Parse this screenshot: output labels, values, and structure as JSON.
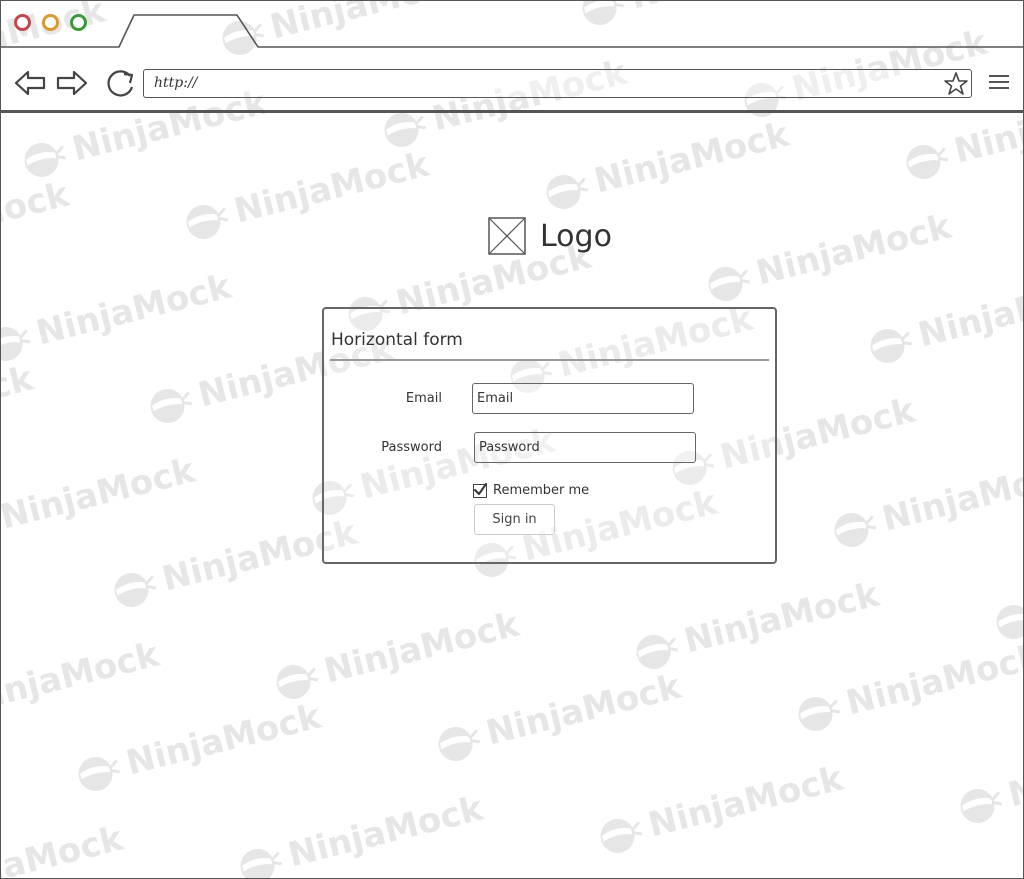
{
  "watermark": {
    "text": "NinjaMock"
  },
  "browser": {
    "window_controls": [
      "close",
      "minimize",
      "maximize"
    ],
    "url": "http://",
    "icons": {
      "back": "back-arrow-icon",
      "forward": "forward-arrow-icon",
      "reload": "reload-icon",
      "bookmark": "star-icon",
      "menu": "hamburger-menu-icon"
    }
  },
  "logo": {
    "text": "Logo",
    "icon": "image-placeholder-icon"
  },
  "form": {
    "title": "Horizontal form",
    "email": {
      "label": "Email",
      "placeholder": "Email",
      "value": ""
    },
    "password": {
      "label": "Password",
      "placeholder": "Password",
      "value": ""
    },
    "remember": {
      "label": "Remember me",
      "checked": true
    },
    "submit_label": "Sign in"
  },
  "colors": {
    "close_dot": "#c0484a",
    "minimize_dot": "#d99a2b",
    "maximize_dot": "#3a9a3a",
    "watermark": "#e6e6e6",
    "outline": "#555555"
  }
}
